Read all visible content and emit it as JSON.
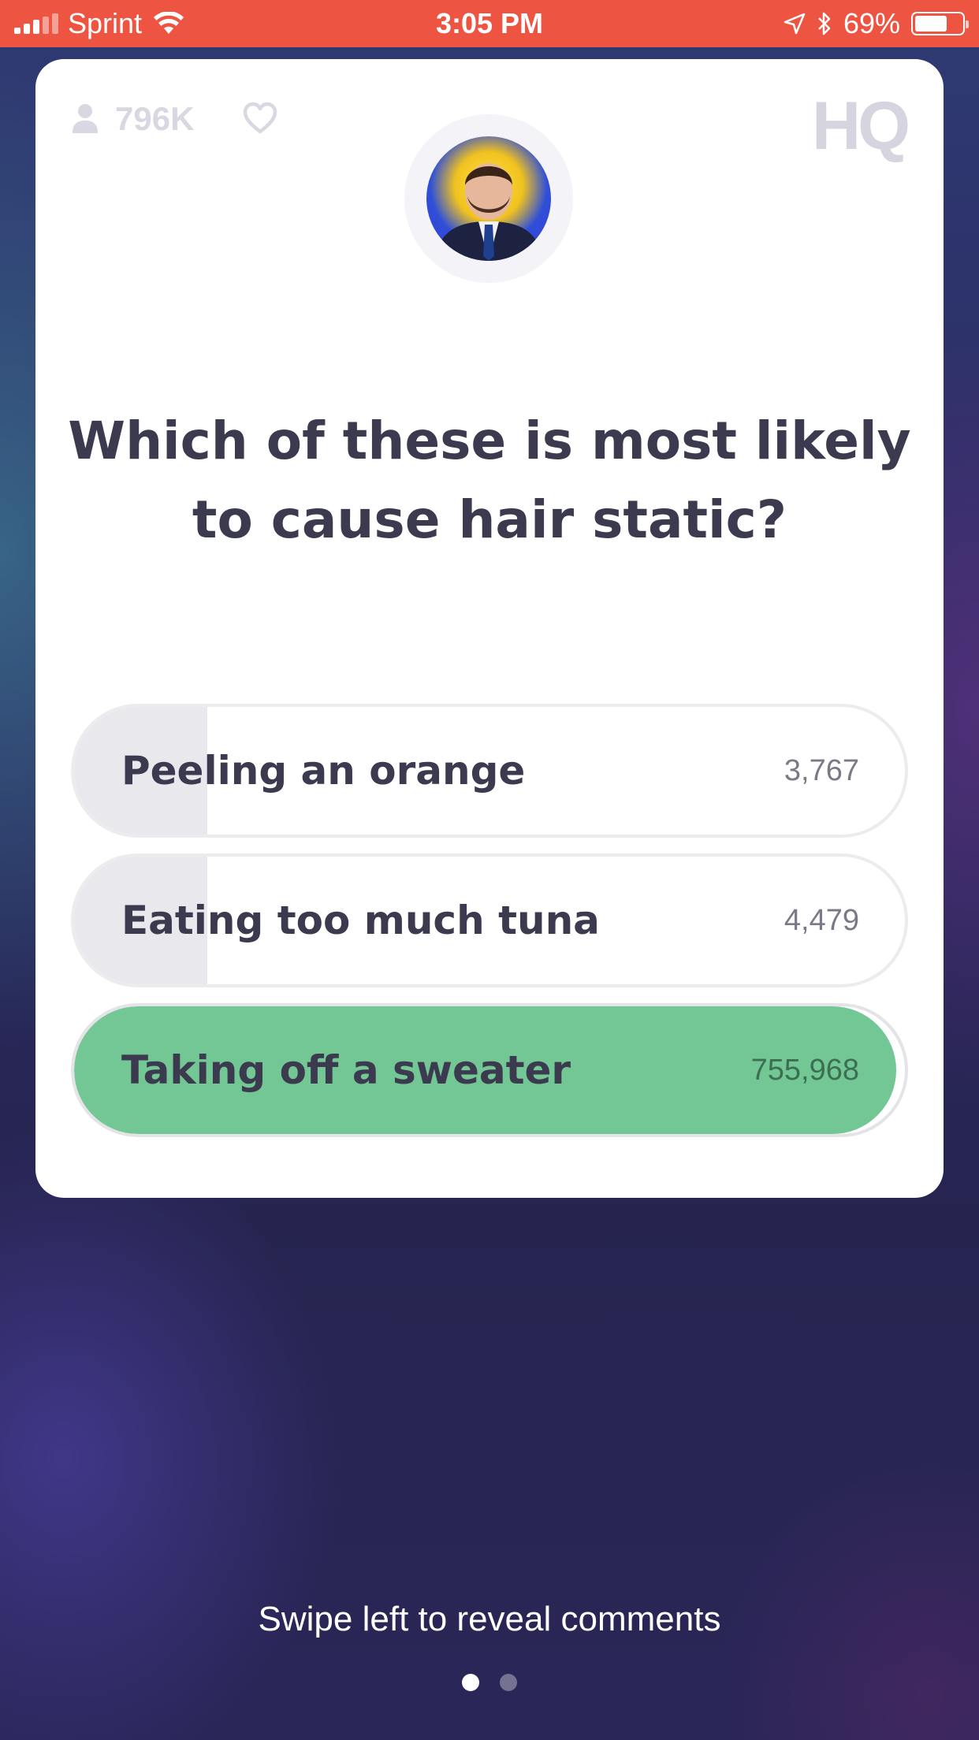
{
  "status_bar": {
    "carrier": "Sprint",
    "time": "3:05 PM",
    "battery": "69%",
    "battery_level": 0.69
  },
  "card": {
    "viewers": "796K",
    "logo": "HQ",
    "question": "Which of these is most likely to cause hair static?",
    "answers": [
      {
        "label": "Peeling an orange",
        "count": "3,767",
        "fill": 0.16,
        "correct": false
      },
      {
        "label": "Eating too much tuna",
        "count": "4,479",
        "fill": 0.16,
        "correct": false
      },
      {
        "label": "Taking off a sweater",
        "count": "755,968",
        "fill": 0.99,
        "correct": true
      }
    ]
  },
  "footer": {
    "swipe_hint": "Swipe left to reveal comments",
    "page_dots": {
      "total": 2,
      "active": 0
    }
  },
  "colors": {
    "status_bar": "#ee5442",
    "correct_answer": "#73c795",
    "background": "#272552"
  }
}
